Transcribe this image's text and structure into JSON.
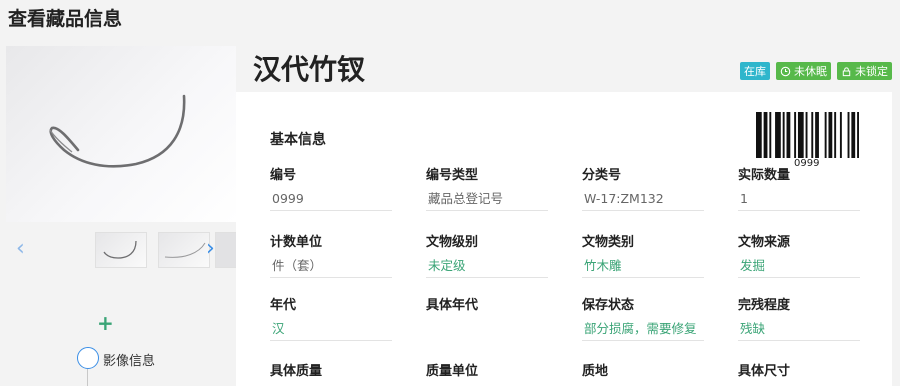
{
  "page": {
    "title": "查看藏品信息"
  },
  "item": {
    "name": "汉代竹钗"
  },
  "badges": [
    {
      "label": "在库",
      "color": "#2fb6cc",
      "icon": ""
    },
    {
      "label": "未休眠",
      "color": "#57b94a",
      "icon": "clock-icon"
    },
    {
      "label": "未锁定",
      "color": "#57b94a",
      "icon": "lock-icon"
    }
  ],
  "gallery": {
    "prev_icon": "chevron-left-icon",
    "next_icon": "chevron-right-icon",
    "arrows": {
      "prev": "‹",
      "next": "›"
    }
  },
  "sidebar": {
    "add_icon": "+",
    "timeline_label": "影像信息"
  },
  "barcode": {
    "number": "0999"
  },
  "basic": {
    "section_title": "基本信息",
    "fields": [
      {
        "label": "编号",
        "value": "0999",
        "style": "gray"
      },
      {
        "label": "编号类型",
        "value": "藏品总登记号",
        "style": "gray"
      },
      {
        "label": "分类号",
        "value": "W-17:ZM132",
        "style": "gray"
      },
      {
        "label": "实际数量",
        "value": "1",
        "style": "gray"
      },
      {
        "label": "计数单位",
        "value": "件（套）",
        "style": "gray"
      },
      {
        "label": "文物级别",
        "value": "未定级",
        "style": "green"
      },
      {
        "label": "文物类别",
        "value": "竹木雕",
        "style": "green"
      },
      {
        "label": "文物来源",
        "value": "发掘",
        "style": "green"
      },
      {
        "label": "年代",
        "value": "汉",
        "style": "green"
      },
      {
        "label": "具体年代",
        "value": "",
        "style": "none"
      },
      {
        "label": "保存状态",
        "value": "部分损腐，需要修复",
        "style": "green"
      },
      {
        "label": "完残程度",
        "value": "残缺",
        "style": "green"
      },
      {
        "label": "具体质量",
        "value": "",
        "style": "none"
      },
      {
        "label": "质量单位",
        "value": "",
        "style": "none"
      },
      {
        "label": "质地",
        "value": "",
        "style": "none"
      },
      {
        "label": "具体尺寸",
        "value": "",
        "style": "none"
      }
    ]
  }
}
